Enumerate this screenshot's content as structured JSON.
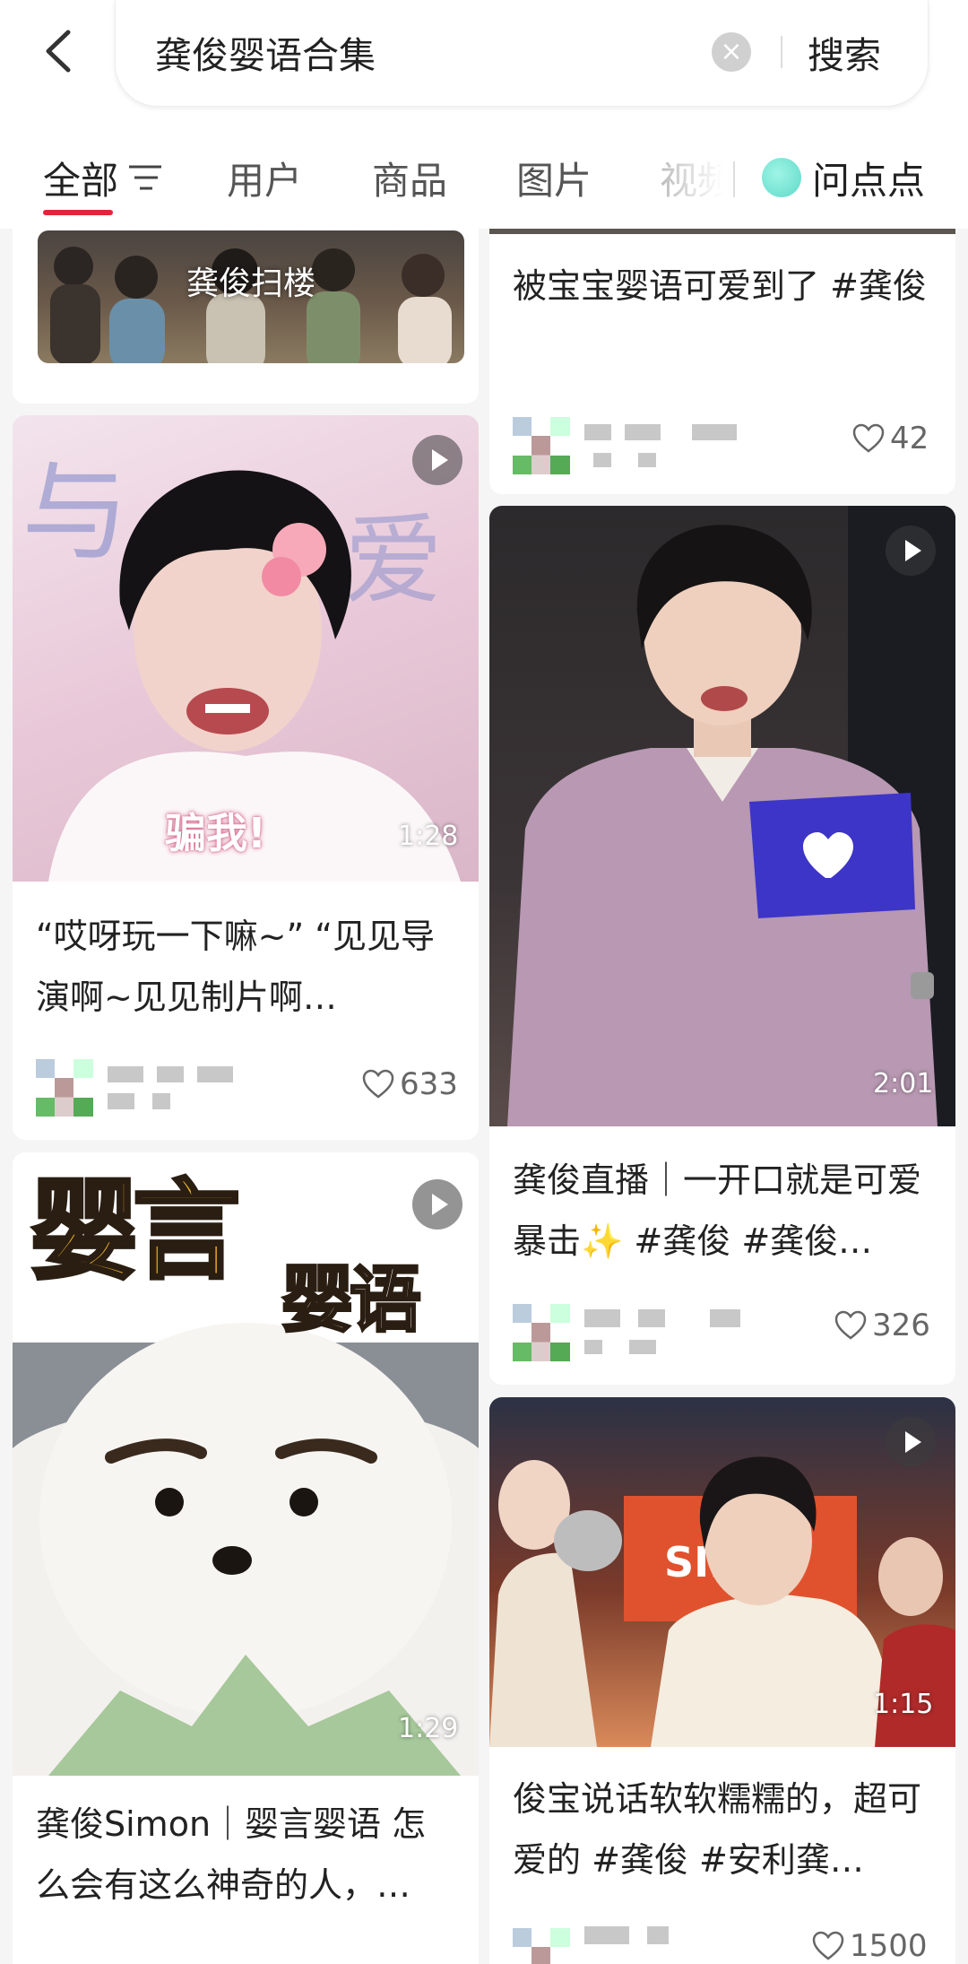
{
  "search": {
    "query": "龚俊婴语合集",
    "button_label": "搜索"
  },
  "tabs": [
    {
      "label": "全部"
    },
    {
      "label": "用户"
    },
    {
      "label": "商品"
    },
    {
      "label": "图片"
    },
    {
      "label": "视频"
    },
    {
      "label": "问点点"
    }
  ],
  "cards": {
    "left1": {
      "overlay_text": "龚俊扫楼"
    },
    "right1": {
      "title": "被宝宝婴语可爱到了 #龚俊",
      "likes": "42"
    },
    "left2": {
      "caption_text": "骗我!",
      "duration": "1:28",
      "title": "“哎呀玩一下嘛~” “见见导演啊~见见制片啊…",
      "likes": "633"
    },
    "right2": {
      "duration": "2:01",
      "title": "龚俊直播｜一开口就是可爱暴击✨ #龚俊 #龚俊…",
      "likes": "326"
    },
    "left3": {
      "sticker_top": "婴言",
      "sticker_bottom": "婴语",
      "duration": "1:29",
      "title": "龚俊Simon｜婴言婴语 怎么会有这么神奇的人，…"
    },
    "right3": {
      "duration": "1:15",
      "title": "俊宝说话软软糯糯的，超可爱的 #龚俊 #安利龚…",
      "likes": "1500"
    }
  },
  "colors": {
    "accent": "#e0263a",
    "qa_icon": "#6fe0cf"
  },
  "icons": [
    "back-arrow-icon",
    "clear-icon",
    "filter-icon",
    "qa-bubble-icon",
    "play-icon",
    "heart-icon"
  ]
}
